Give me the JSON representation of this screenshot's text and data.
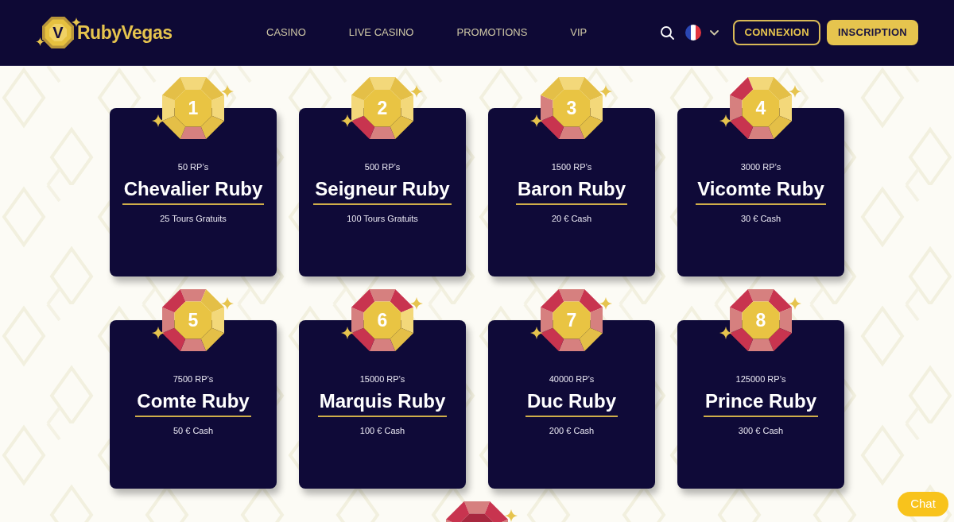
{
  "header": {
    "logo": {
      "mark": "V",
      "name": "RubyVegas"
    },
    "nav": [
      "CASINO",
      "LIVE CASINO",
      "PROMOTIONS",
      "VIP"
    ],
    "buttons": [
      {
        "label": "CONNEXION",
        "kind": "outline"
      },
      {
        "label": "INSCRIPTION",
        "kind": "filled"
      }
    ]
  },
  "tiers": [
    {
      "number": "1",
      "points": "50 RP’s",
      "title": "Chevalier Ruby",
      "reward": "25 Tours Gratuits"
    },
    {
      "number": "2",
      "points": "500 RP’s",
      "title": "Seigneur Ruby",
      "reward": "100 Tours Gratuits"
    },
    {
      "number": "3",
      "points": "1500 RP’s",
      "title": "Baron Ruby",
      "reward": "20 € Cash"
    },
    {
      "number": "4",
      "points": "3000 RP’s",
      "title": "Vicomte Ruby",
      "reward": "30 € Cash"
    },
    {
      "number": "5",
      "points": "7500 RP’s",
      "title": "Comte Ruby",
      "reward": "50 € Cash"
    },
    {
      "number": "6",
      "points": "15000 RP’s",
      "title": "Marquis Ruby",
      "reward": "100 € Cash"
    },
    {
      "number": "7",
      "points": "40000 RP’s",
      "title": "Duc Ruby",
      "reward": "200 € Cash"
    },
    {
      "number": "8",
      "points": "125000 RP’s",
      "title": "Prince Ruby",
      "reward": "300 € Cash"
    }
  ],
  "next_tier": {
    "kind": "gem"
  },
  "chat_button": {
    "label": "Chat"
  }
}
